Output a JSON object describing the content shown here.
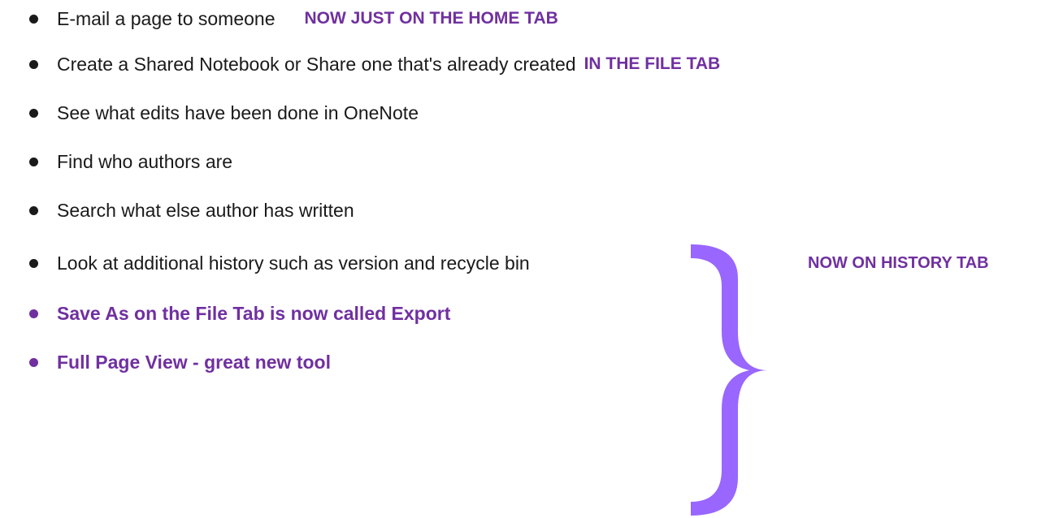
{
  "items": [
    {
      "text": "E-mail a page to someone",
      "note": "NOW JUST ON THE HOME TAB"
    },
    {
      "text": "Create a Shared Notebook or Share one that's already created",
      "note": "IN THE FILE TAB"
    },
    {
      "text": "See what edits have been done in OneNote"
    },
    {
      "text": "Find who authors are"
    },
    {
      "text": "Search what else author has written"
    },
    {
      "text": "Look at additional history such as version and recycle bin"
    },
    {
      "text": "Save As on the File Tab is now called Export"
    },
    {
      "text": "Full Page View - great new tool"
    }
  ],
  "history_note": "NOW ON HISTORY TAB",
  "colors": {
    "accent": "#7030a0",
    "brace": "#9966ff",
    "text": "#1a1a1a"
  }
}
